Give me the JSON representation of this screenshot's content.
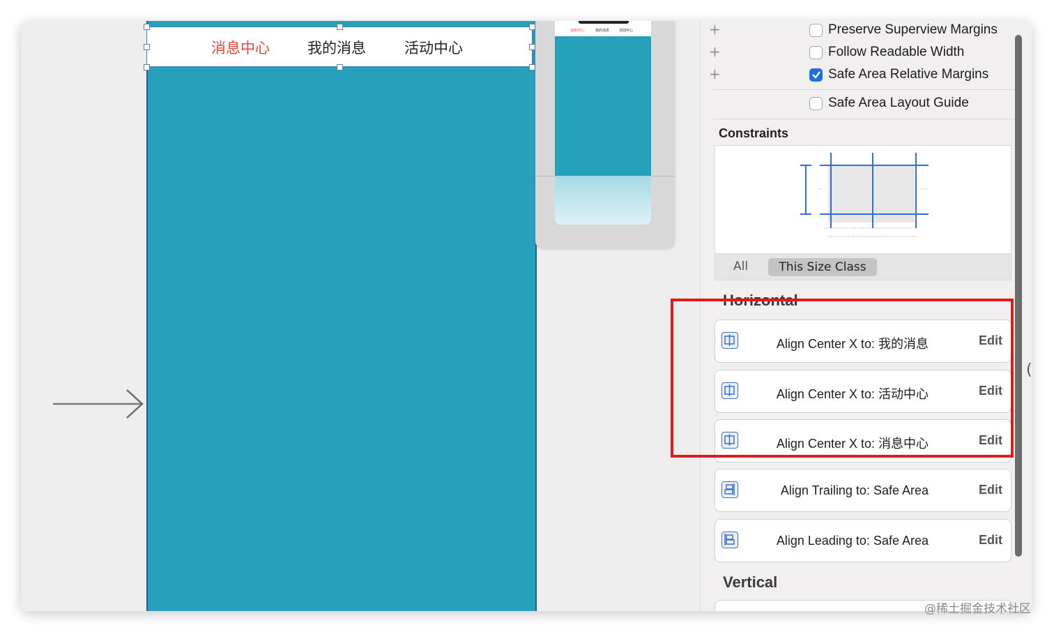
{
  "canvas": {
    "segments": [
      {
        "label": "消息中心",
        "active": true
      },
      {
        "label": "我的消息",
        "active": false
      },
      {
        "label": "活动中心",
        "active": false
      }
    ],
    "device_color": "#27a0bb",
    "active_color": "#e8453c"
  },
  "inspector": {
    "layout_margins": {
      "options": [
        {
          "label": "Preserve Superview Margins",
          "checked": false
        },
        {
          "label": "Follow Readable Width",
          "checked": false
        },
        {
          "label": "Safe Area Relative Margins",
          "checked": true
        }
      ]
    },
    "safe_area_layout_guide": {
      "label": "Safe Area Layout Guide",
      "checked": false
    },
    "constraints_title": "Constraints",
    "size_class": {
      "all_label": "All",
      "this_label": "This Size Class"
    },
    "horizontal_title": "Horizontal",
    "horizontal": [
      {
        "description": "Align Center X to:  我的消息",
        "edit": "Edit",
        "icon": "center-x-icon"
      },
      {
        "description": "Align Center X to:  活动中心",
        "edit": "Edit",
        "icon": "center-x-icon"
      },
      {
        "description": "Align Center X to:  消息中心",
        "edit": "Edit",
        "icon": "center-x-icon"
      },
      {
        "description": "Align Trailing to:  Safe Area",
        "edit": "Edit",
        "icon": "trailing-icon"
      },
      {
        "description": "Align Leading to:  Safe Area",
        "edit": "Edit",
        "icon": "leading-icon"
      }
    ],
    "vertical_title": "Vertical",
    "accent_color": "#1f6fe0",
    "highlight_color": "#e11b1b"
  },
  "watermark": "@稀土掘金技术社区"
}
